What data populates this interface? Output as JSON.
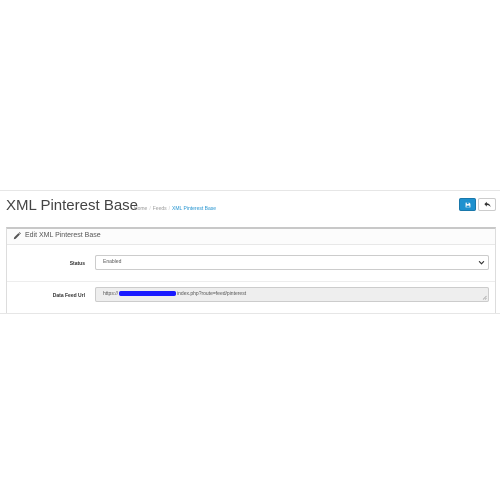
{
  "header": {
    "title": "XML Pinterest Base",
    "breadcrumb": [
      {
        "label": "Home"
      },
      {
        "label": "Feeds"
      },
      {
        "label": "XML Pinterest Base"
      }
    ],
    "save_icon": "save-icon",
    "back_icon": "reply-icon"
  },
  "panel": {
    "title": "Edit XML Pinterest Base",
    "icon": "pencil-icon"
  },
  "form": {
    "status": {
      "label": "Status",
      "value": "Enabled"
    },
    "data_feed_url": {
      "label": "Data Feed Url",
      "value_prefix": "https://",
      "value_suffix": "index.php?route=feed/pinterest"
    }
  },
  "colors": {
    "primary": "#1e91cf",
    "breadcrumb_active": "#1e91cf",
    "redaction": "#1a1aff",
    "readonly_bg": "#eeeeee"
  }
}
